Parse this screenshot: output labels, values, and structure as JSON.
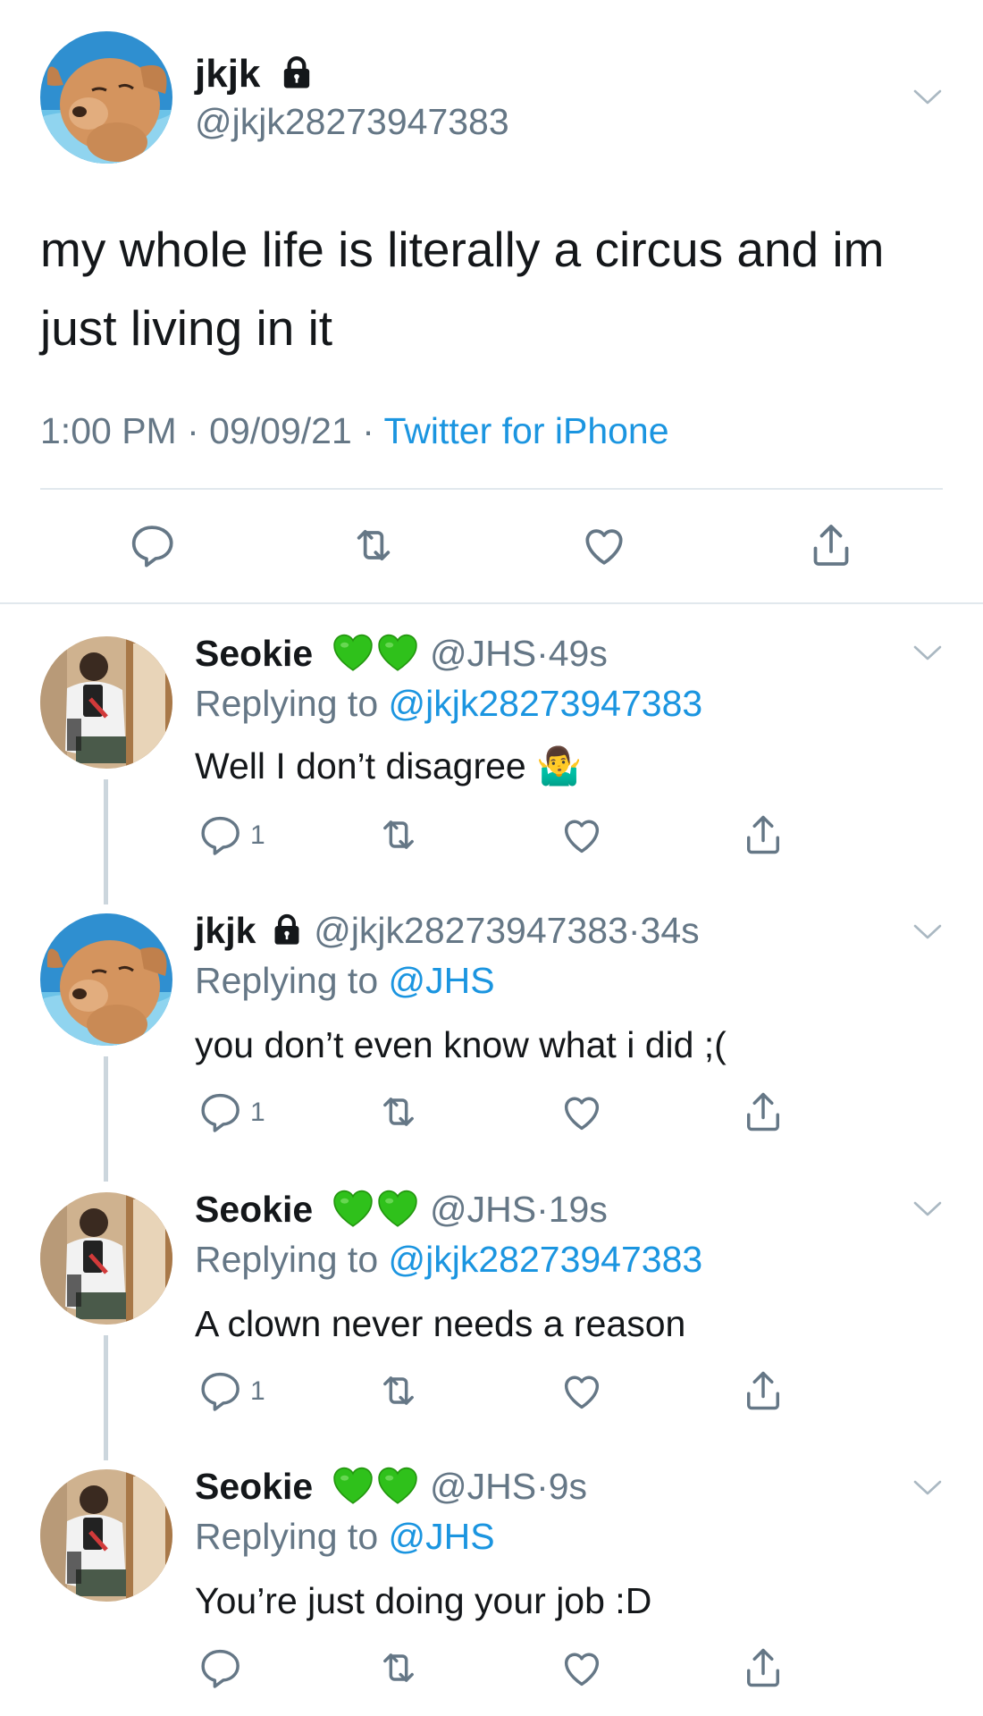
{
  "main_tweet": {
    "author_name": "jkjk",
    "handle": "@jkjk28273947383",
    "text": "my whole life is literally a circus and im just living in it",
    "time": "1:00 PM",
    "date": "09/09/21",
    "source": "Twitter for iPhone",
    "separator": "·",
    "avatar_icon": "puppy-avatar",
    "locked": true
  },
  "replies": [
    {
      "author_name": "Seokie",
      "handle": "@JHS",
      "age": "49s",
      "replying_label": "Replying to",
      "replying_to": "@jkjk28273947383",
      "text": "Well I don’t disagree",
      "emoji": "🤷‍♂️",
      "reply_count": "1",
      "avatar_icon": "mirror-selfie-avatar"
    },
    {
      "author_name": "jkjk",
      "handle": "@jkjk28273947383",
      "age": "34s",
      "replying_label": "Replying to",
      "replying_to": "@JHS",
      "text": "you don’t even know what i did ;(",
      "reply_count": "1",
      "avatar_icon": "puppy-avatar"
    },
    {
      "author_name": "Seokie",
      "handle": "@JHS",
      "age": "19s",
      "replying_label": "Replying to",
      "replying_to": "@jkjk28273947383",
      "text": "A clown never needs a reason",
      "reply_count": "1",
      "avatar_icon": "mirror-selfie-avatar"
    },
    {
      "author_name": "Seokie",
      "handle": "@JHS",
      "age": "9s",
      "replying_label": "Replying to",
      "replying_to": "@JHS",
      "text": "You’re just doing your job :D",
      "reply_count": "",
      "avatar_icon": "mirror-selfie-avatar"
    }
  ],
  "colors": {
    "link": "#1b95e0",
    "muted": "#657786",
    "text": "#14171a",
    "divider": "#e1e8ed",
    "green_heart": "#2fc11b"
  }
}
